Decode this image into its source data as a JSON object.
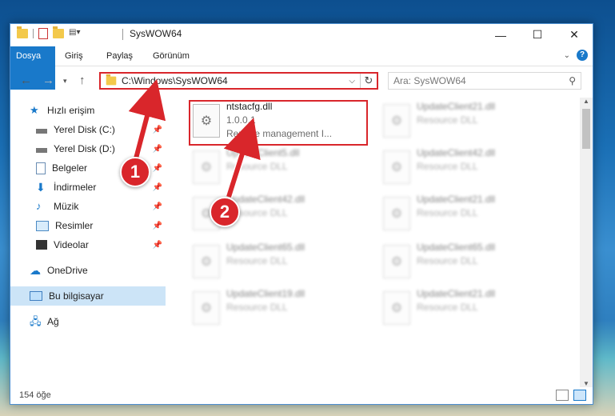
{
  "window": {
    "title": "SysWOW64",
    "caption": {
      "minimize": "—",
      "maximize": "☐",
      "close": "✕"
    }
  },
  "ribbon": {
    "tabs": [
      "Dosya",
      "Giriş",
      "Paylaş",
      "Görünüm"
    ],
    "help": "?"
  },
  "address": {
    "path": "C:\\Windows\\SysWOW64",
    "search_placeholder": "Ara: SysWOW64"
  },
  "nav": {
    "quick_access": "Hızlı erişim",
    "items": [
      {
        "label": "Yerel Disk (C:)",
        "icon": "drive-icon"
      },
      {
        "label": "Yerel Disk (D:)",
        "icon": "drive-icon"
      },
      {
        "label": "Belgeler",
        "icon": "documents-icon"
      },
      {
        "label": "İndirmeler",
        "icon": "download-icon"
      },
      {
        "label": "Müzik",
        "icon": "music-icon"
      },
      {
        "label": "Resimler",
        "icon": "pictures-icon"
      },
      {
        "label": "Videolar",
        "icon": "video-icon"
      }
    ],
    "onedrive": "OneDrive",
    "this_pc": "Bu bilgisayar",
    "network": "Ağ"
  },
  "files": [
    {
      "name": "ntstacfg.dll",
      "line2": "1.0.0.1",
      "line3": "Remote management I..."
    },
    {
      "name": "UpdateClient21.dll",
      "line2": "Resource DLL"
    },
    {
      "name": "UpdateClient5.dll",
      "line2": "Resource DLL"
    },
    {
      "name": "UpdateClient42.dll",
      "line2": "Resource DLL"
    },
    {
      "name": "UpdateClient42.dll",
      "line2": "Resource DLL"
    },
    {
      "name": "UpdateClient21.dll",
      "line2": "Resource DLL"
    },
    {
      "name": "UpdateClient65.dll",
      "line2": "Resource DLL"
    },
    {
      "name": "UpdateClient65.dll",
      "line2": "Resource DLL"
    },
    {
      "name": "UpdateClient19.dll",
      "line2": "Resource DLL"
    },
    {
      "name": "UpdateClient21.dll",
      "line2": "Resource DLL"
    }
  ],
  "status": {
    "count": "154 öğe"
  },
  "annotations": [
    "1",
    "2"
  ],
  "colors": {
    "accent": "#1979ca",
    "highlight": "#d9262b"
  }
}
